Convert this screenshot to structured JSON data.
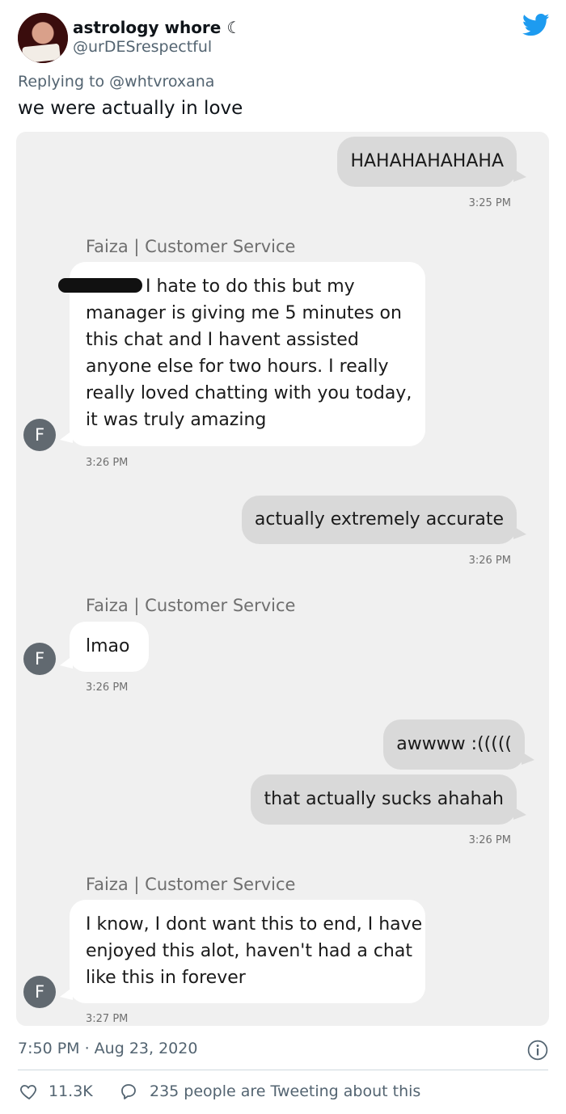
{
  "tweet": {
    "display_name": "astrology whore ☾",
    "handle": "@urDESrespectful",
    "replying_prefix": "Replying to",
    "replying_to": "@whtvroxana",
    "text": "we were actually in love",
    "brand_color": "#1d9bf0"
  },
  "chat": {
    "agent_name": "Faiza | Customer Service",
    "agent_initial": "F",
    "messages": [
      {
        "from": "user",
        "text": "HAHAHAHAHAHA",
        "time": "3:25 PM"
      },
      {
        "from": "agent",
        "text": "I hate to do this but my manager is giving me 5 minutes on this chat and I havent assisted anyone else for two hours. I really really loved chatting with you today, it was truly amazing",
        "time": "3:26 PM"
      },
      {
        "from": "user",
        "text": "actually extremely accurate",
        "time": "3:26 PM"
      },
      {
        "from": "agent",
        "text": "lmao",
        "time": "3:26 PM"
      },
      {
        "from": "user",
        "text": "awwww :(((((",
        "time": ""
      },
      {
        "from": "user",
        "text": "that actually sucks ahahah",
        "time": "3:26 PM"
      },
      {
        "from": "agent",
        "text": "I know, I dont want this to end, I have enjoyed this alot, haven't had a chat like this in forever",
        "time": "3:27 PM"
      }
    ]
  },
  "footer": {
    "time": "7:50 PM · Aug 23, 2020",
    "likes": "11.3K",
    "tweeting": "235 people are Tweeting about this"
  }
}
